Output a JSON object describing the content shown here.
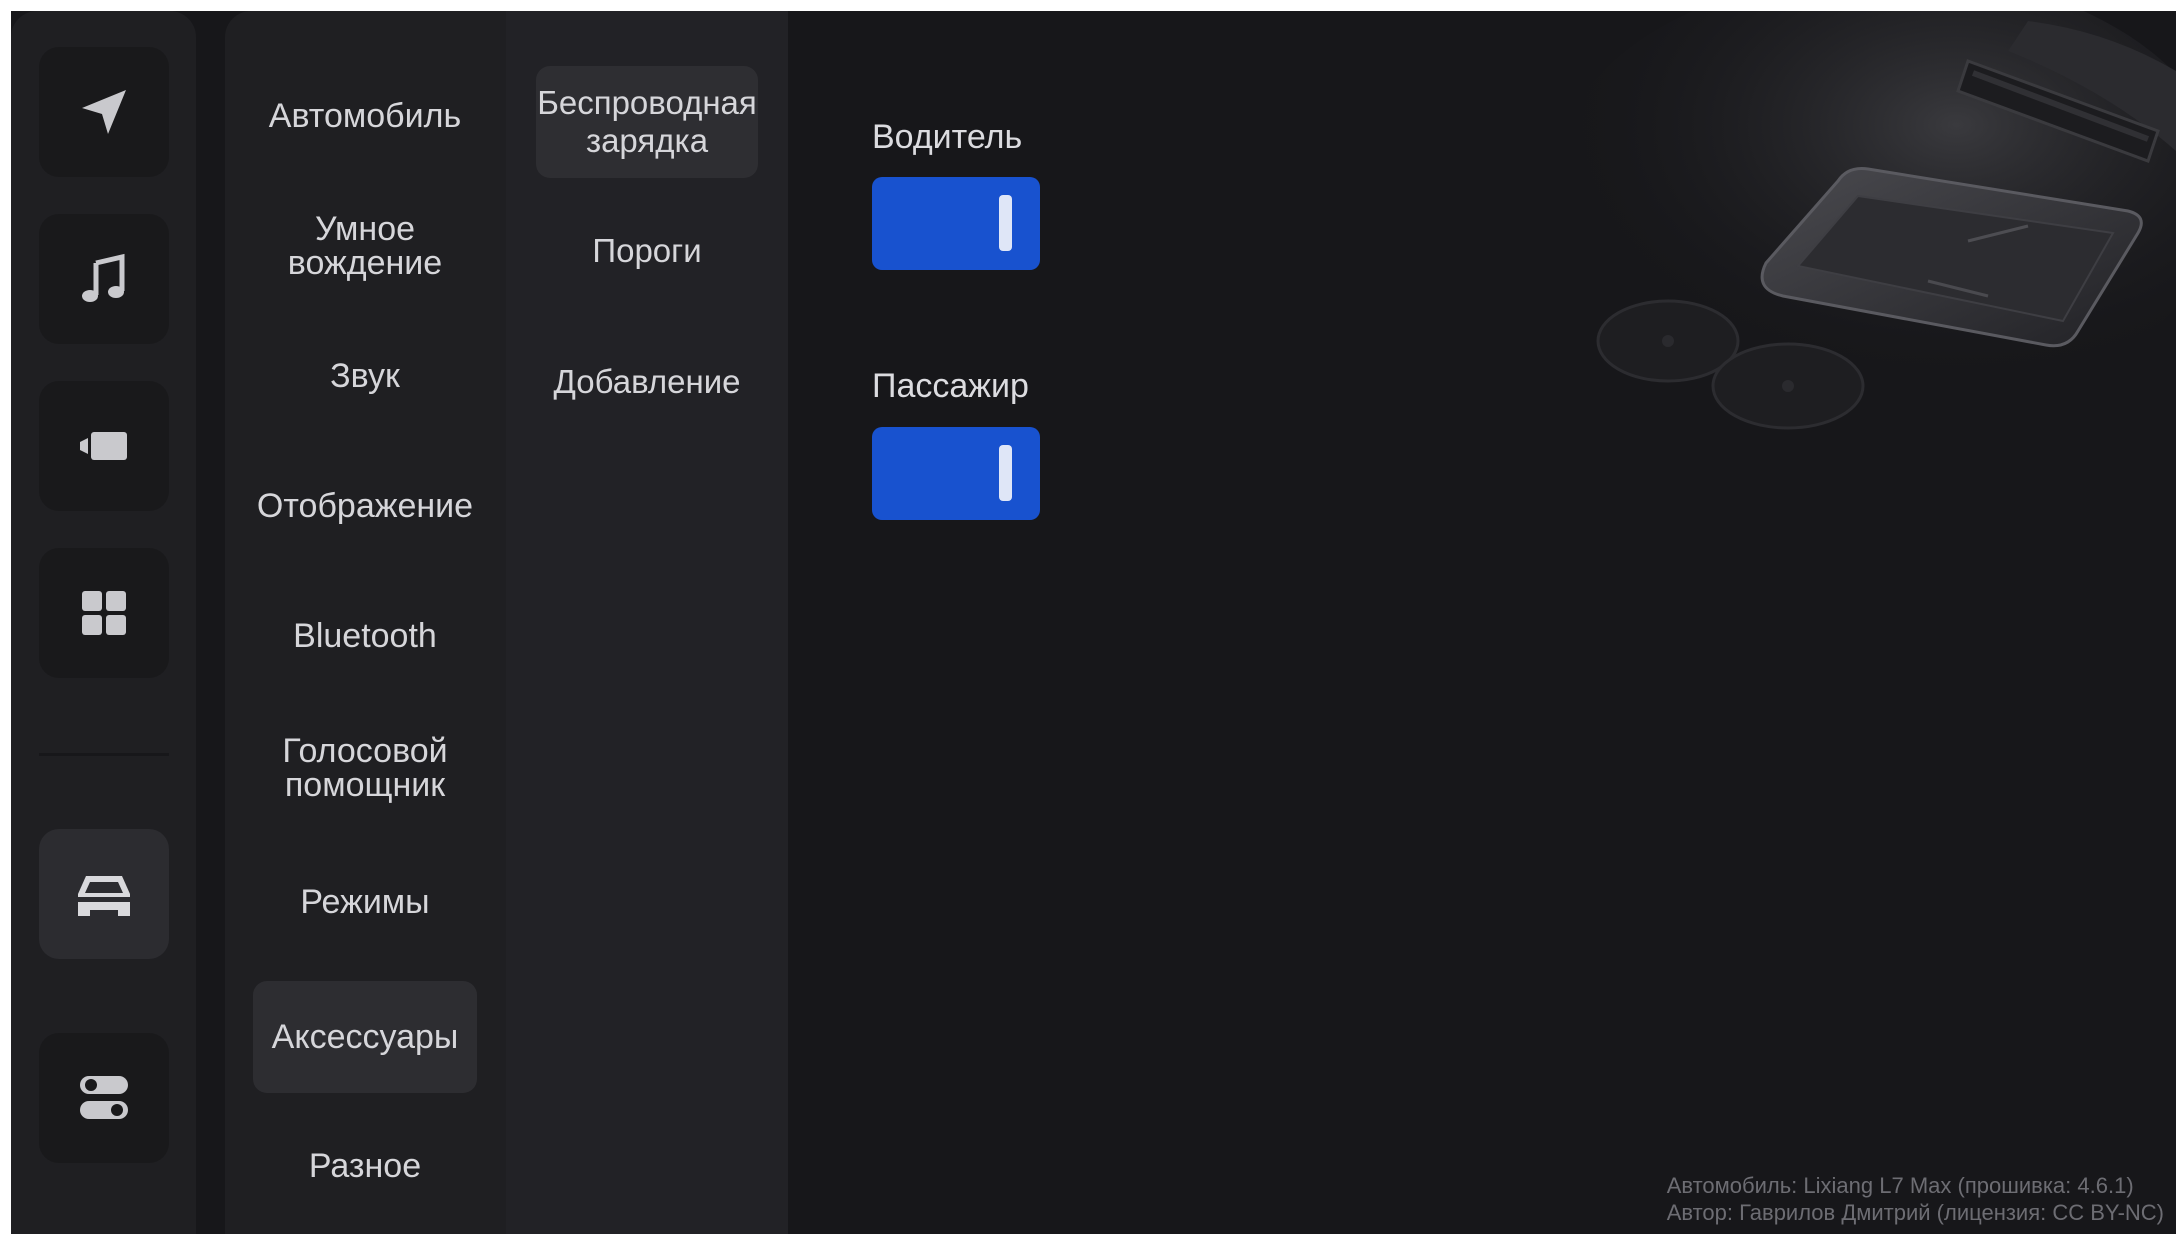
{
  "rail": {
    "items": [
      {
        "icon": "navigation-arrow-icon"
      },
      {
        "icon": "music-note-icon"
      },
      {
        "icon": "video-camera-icon"
      },
      {
        "icon": "apps-grid-icon"
      },
      {
        "icon": "car-icon",
        "active": true
      },
      {
        "icon": "toggles-settings-icon"
      }
    ]
  },
  "menu": {
    "items": [
      {
        "label": "Автомобиль"
      },
      {
        "label": "Умное вождение"
      },
      {
        "label": "Звук"
      },
      {
        "label": "Отображение"
      },
      {
        "label": "Bluetooth"
      },
      {
        "label": "Голосовой помощник"
      },
      {
        "label": "Режимы"
      },
      {
        "label": "Аксессуары",
        "active": true
      },
      {
        "label": "Разное"
      }
    ]
  },
  "submenu": {
    "items": [
      {
        "label": "Беспроводная зарядка",
        "active": true
      },
      {
        "label": "Пороги"
      },
      {
        "label": "Добавление"
      }
    ]
  },
  "content": {
    "driver_label": "Водитель",
    "driver_on": true,
    "passenger_label": "Пассажир",
    "passenger_on": true
  },
  "footer": {
    "line1": "Автомобиль: Lixiang L7 Max (прошивка: 4.6.1)",
    "line2": "Автор: Гаврилов Дмитрий (лицензия: CC BY-NC)"
  },
  "colors": {
    "background": "#17171a",
    "panel": "#1f1f22",
    "accent_blue": "#1852cf",
    "text": "#d6d6da"
  }
}
